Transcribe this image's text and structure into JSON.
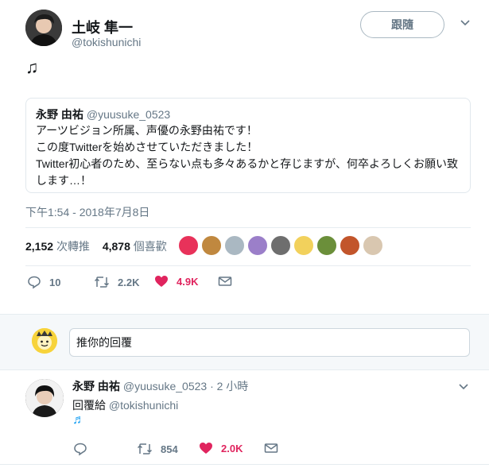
{
  "tweet": {
    "author_name": "土岐 隼一",
    "author_handle": "@tokishunichi",
    "follow_label": "跟隨",
    "text": "♫",
    "timestamp": "下午1:54 - 2018年7月8日",
    "quote": {
      "name": "永野 由祐",
      "handle": "@yuusuke_0523",
      "lines": [
        "アーツビジョン所属、声優の永野由祐です！",
        "この度Twitterを始めさせていただきました！",
        "Twitter初心者のため、至らない点も多々あるかと存じますが、何卒よろしくお願い致",
        "します…！"
      ]
    },
    "stats": {
      "retweets": "2,152",
      "retweets_label": "次轉推",
      "likes": "4,878",
      "likes_label": "個喜歡"
    },
    "actions": {
      "reply_count": "10",
      "retweet_count": "2.2K",
      "like_count": "4.9K"
    },
    "liker_colors": [
      "#e8325a",
      "#c0883f",
      "#aab8c2",
      "#9b7fc9",
      "#6e6e6e",
      "#f2d15c",
      "#6b8f3a",
      "#c2552b",
      "#d9c7b0"
    ]
  },
  "reply_box": {
    "placeholder": "推你的回覆"
  },
  "reply": {
    "name": "永野 由祐",
    "handle": "@yuusuke_0523",
    "time": "· 2 小時",
    "replying_to_label": "回覆給",
    "replying_to_handle": "@tokishunichi",
    "text": "♬",
    "actions": {
      "reply_count": "",
      "retweet_count": "854",
      "like_count": "2.0K"
    }
  },
  "colors": {
    "accent": "#1da1f2",
    "like": "#e0245e",
    "muted": "#657786",
    "border": "#e6ecf0"
  }
}
